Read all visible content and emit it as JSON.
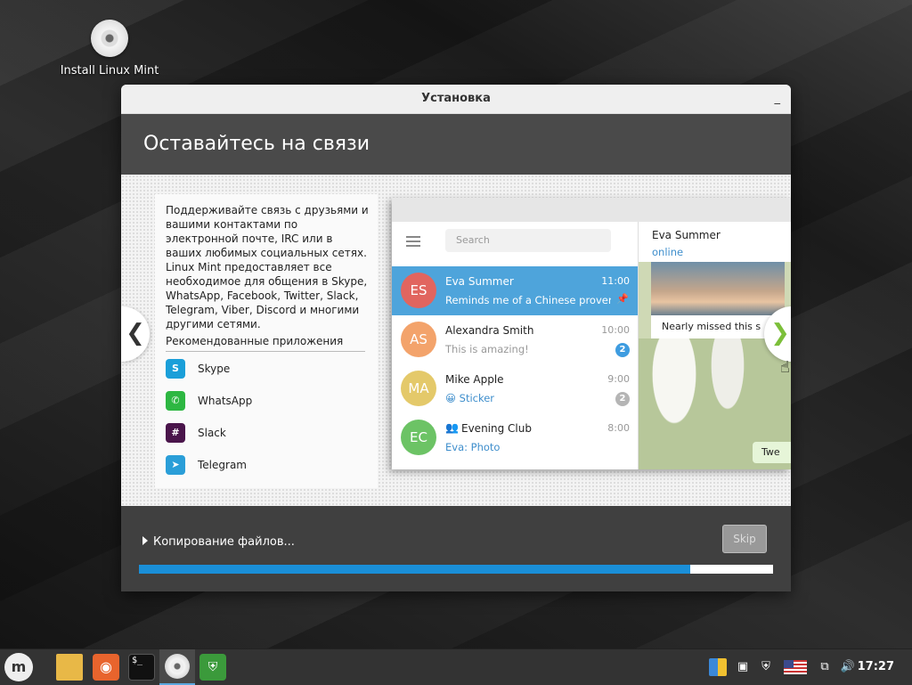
{
  "desktop": {
    "icon_label": "Install Linux Mint"
  },
  "window": {
    "title": "Установка",
    "minimize": "_",
    "header": "Оставайтесь на связи"
  },
  "slide": {
    "description": "Поддерживайте связь с друзьями и вашими контактами по электронной почте, IRC или в ваших любимых социальных сетях. Linux Mint предоставляет все необходимое для общения в Skype, WhatsApp, Facebook, Twitter, Slack, Telegram, Viber, Discord и многими другими сетями.",
    "recommended_title": "Рекомендованные приложения",
    "apps": [
      {
        "name": "Skype",
        "icon": "skype-icon",
        "color": "#1a9fd9"
      },
      {
        "name": "WhatsApp",
        "icon": "whatsapp-icon",
        "color": "#2db742"
      },
      {
        "name": "Slack",
        "icon": "slack-icon",
        "color": "#4a154b"
      },
      {
        "name": "Telegram",
        "icon": "telegram-icon",
        "color": "#2a9ed8"
      }
    ],
    "prev_arrow": "❮",
    "next_arrow": "❯"
  },
  "telegram": {
    "search_placeholder": "Search",
    "chats": [
      {
        "initials": "ES",
        "name": "Eva Summer",
        "time": "11:00",
        "message": "Reminds me of a Chinese prover...",
        "color": "#e1655f",
        "pinned": true
      },
      {
        "initials": "AS",
        "name": "Alexandra Smith",
        "time": "10:00",
        "message": "This is amazing!",
        "badge": "2",
        "color": "#f3a36b"
      },
      {
        "initials": "MA",
        "name": "Mike Apple",
        "time": "9:00",
        "message": "😀 Sticker",
        "badge": "2",
        "color": "#e4c96a"
      },
      {
        "initials": "EC",
        "name": "Evening Club",
        "time": "8:00",
        "message": "Eva: Photo",
        "color": "#6cc365"
      }
    ],
    "right_name": "Eva Summer",
    "right_status": "online",
    "photo_caption": "Nearly missed this s",
    "bubble_text": "Twe"
  },
  "footer": {
    "status": "Копирование файлов...",
    "skip_label": "Skip",
    "progress_percent": 87
  },
  "taskbar": {
    "clock": "17:27",
    "accent": "#5aa8e0"
  }
}
